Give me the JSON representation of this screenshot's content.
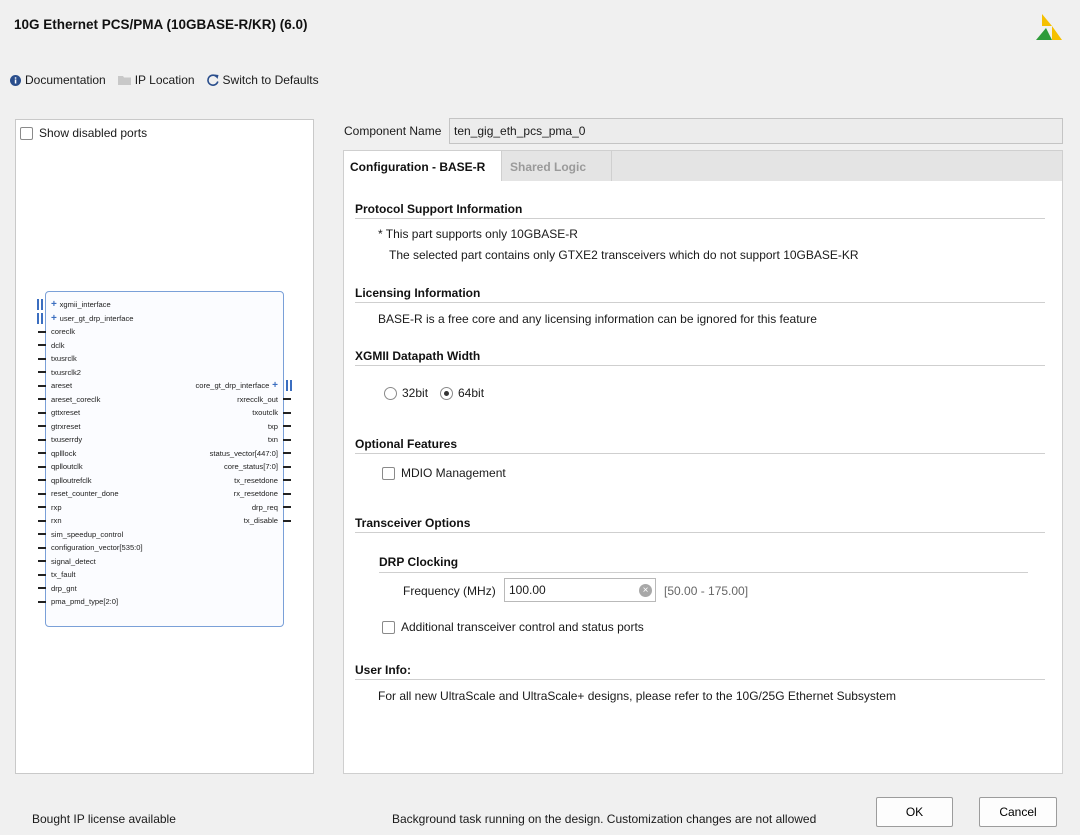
{
  "window": {
    "title": "10G Ethernet PCS/PMA (10GBASE-R/KR) (6.0)"
  },
  "toolbar": {
    "documentation": "Documentation",
    "ip_location": "IP Location",
    "switch_defaults": "Switch to Defaults"
  },
  "left_panel": {
    "show_disabled_ports": "Show disabled ports",
    "left_ports": [
      "xgmii_interface",
      "user_gt_drp_interface",
      "coreclk",
      "dclk",
      "txusrclk",
      "txusrclk2",
      "areset",
      "areset_coreclk",
      "gttxreset",
      "gtrxreset",
      "txuserrdy",
      "qplllock",
      "qplloutclk",
      "qplloutrefclk",
      "reset_counter_done",
      "rxp",
      "rxn",
      "sim_speedup_control",
      "configuration_vector[535:0]",
      "signal_detect",
      "tx_fault",
      "drp_gnt",
      "pma_pmd_type[2:0]"
    ],
    "right_ports": [
      "core_gt_drp_interface",
      "rxrecclk_out",
      "txoutclk",
      "txp",
      "txn",
      "status_vector[447:0]",
      "core_status[7:0]",
      "tx_resetdone",
      "rx_resetdone",
      "drp_req",
      "tx_disable"
    ]
  },
  "component": {
    "label": "Component Name",
    "value": "ten_gig_eth_pcs_pma_0"
  },
  "tabs": [
    {
      "label": "Configuration - BASE-R"
    },
    {
      "label": "Shared Logic"
    }
  ],
  "config": {
    "protocol_title": "Protocol Support Information",
    "protocol_line1": "* This part supports only 10GBASE-R",
    "protocol_line2": "The selected part contains only GTXE2 transceivers which do not support 10GBASE-KR",
    "licensing_title": "Licensing Information",
    "licensing_text": "BASE-R is a free core and any licensing information can be ignored for this feature",
    "xgmii_title": "XGMII Datapath Width",
    "radio_32": "32bit",
    "radio_64": "64bit",
    "selected_width": "64bit",
    "optional_title": "Optional Features",
    "mdio_label": "MDIO Management",
    "transceiver_title": "Transceiver Options",
    "drp_title": "DRP Clocking",
    "freq_label": "Frequency (MHz)",
    "freq_value": "100.00",
    "freq_range": "[50.00 - 175.00]",
    "additional_label": "Additional transceiver control and status ports",
    "userinfo_title": "User Info:",
    "userinfo_text": "For all new UltraScale and UltraScale+ designs, please refer to the 10G/25G Ethernet Subsystem"
  },
  "footer": {
    "license_text": "Bought IP license available",
    "status_text": "Background task running on the design. Customization changes are not allowed",
    "ok": "OK",
    "cancel": "Cancel"
  },
  "colors": {
    "accent_blue": "#3b6ec0",
    "logo_yellow": "#f5c000",
    "logo_green": "#2e9b3a"
  }
}
